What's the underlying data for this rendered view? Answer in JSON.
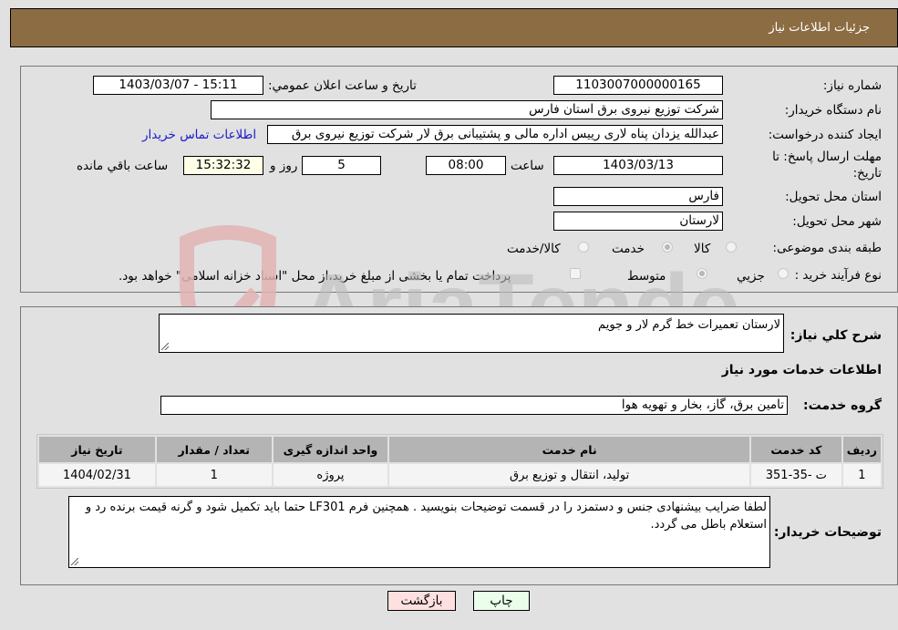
{
  "header": {
    "title": "جزئیات اطلاعات نیاز"
  },
  "fields": {
    "need_number": {
      "label": "شماره نیاز:",
      "value": "1103007000000165"
    },
    "announce_datetime": {
      "label": "تاریخ و ساعت اعلان عمومي:",
      "value": "1403/03/07 - 15:11"
    },
    "buyer_org": {
      "label": "نام دستگاه خریدار:",
      "value": "شرکت توزیع نیروی برق استان فارس"
    },
    "requester": {
      "label": "ایجاد کننده درخواست:",
      "value": "عبدالله یزدان پناه لاری رییس اداره مالی و پشتیبانی برق لار شرکت توزیع نیروی برق"
    },
    "buyer_contact_link": "اطلاعات تماس خریدار",
    "deadline": {
      "label_line1": "مهلت ارسال پاسخ: تا",
      "label_line2": "تاریخ:",
      "date": "1403/03/13",
      "time_label": "ساعت",
      "time": "08:00",
      "days": "5",
      "days_label": "روز و",
      "remaining_time": "15:32:32",
      "remaining_label": "ساعت باقي مانده"
    },
    "delivery_province": {
      "label": "استان محل تحویل:",
      "value": "فارس"
    },
    "delivery_city": {
      "label": "شهر محل تحویل:",
      "value": "لارستان"
    },
    "category": {
      "label": "طبقه بندی موضوعی:",
      "options": [
        "کالا",
        "خدمت",
        "کالا/خدمت"
      ],
      "selected": "خدمت"
    },
    "purchase_type": {
      "label": "نوع فرآیند خرید :",
      "options": [
        "جزيي",
        "متوسط"
      ],
      "selected": "متوسط",
      "treasury_note": "پرداخت تمام یا بخشی از مبلغ خرید،از محل \"اسناد خزانه اسلامی\" خواهد بود.",
      "treasury_checked": false
    }
  },
  "description": {
    "label": "شرح کلي نیاز:",
    "value": "لارستان تعمیرات خط گرم لار و جویم"
  },
  "services_section_title": "اطلاعات خدمات مورد نیاز",
  "service_group": {
    "label": "گروه خدمت:",
    "value": "تامین برق، گاز، بخار و تهویه هوا"
  },
  "table": {
    "headers": [
      "ردیف",
      "کد خدمت",
      "نام خدمت",
      "واحد اندازه گیری",
      "تعداد / مقدار",
      "تاریخ نیاز"
    ],
    "rows": [
      [
        "1",
        "ت -35-351",
        "تولید، انتقال و توزیع برق",
        "پروژه",
        "1",
        "1404/02/31"
      ]
    ]
  },
  "buyer_notes": {
    "label": "توضیحات خریدار:",
    "value": "لطفا ضرایب بیشنهادی جنس و دستمزد را در قسمت توضیحات بنویسید . همچنین فرم LF301 حتما باید تکمیل شود و گرنه قیمت برنده رد و استعلام باطل می گردد."
  },
  "buttons": {
    "print": "چاپ",
    "back": "بازگشت"
  },
  "watermark": {
    "text": "AriaTender.neT"
  }
}
